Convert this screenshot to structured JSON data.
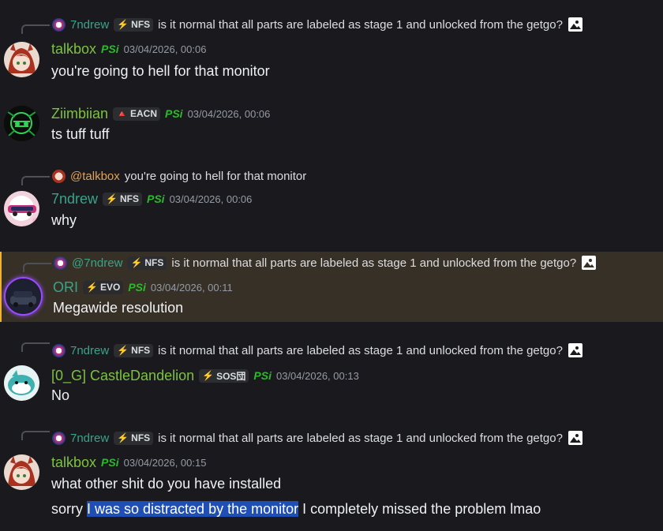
{
  "messages": [
    {
      "reply": {
        "name": "7ndrew",
        "tag": "NFS",
        "text": "is it normal that all parts are labeled as stage 1 and unlocked from the getgo?"
      },
      "author": "talkbox",
      "timestamp": "03/04/2026, 00:06",
      "content": "you're going to hell for that monitor"
    },
    {
      "author": "Ziimbiian",
      "tag": "EACN",
      "timestamp": "03/04/2026, 00:06",
      "content": "ts tuff tuff"
    },
    {
      "reply": {
        "name": "@talkbox",
        "text": "you're going to hell for that monitor"
      },
      "author": "7ndrew",
      "tag": "NFS",
      "timestamp": "03/04/2026, 00:06",
      "content": "why"
    },
    {
      "reply": {
        "name": "@7ndrew",
        "tag": "NFS",
        "text": "is it normal that all parts are labeled as stage 1 and unlocked from the getgo?"
      },
      "author": "ORI",
      "tag": "EVO",
      "timestamp": "03/04/2026, 00:11",
      "content": "Megawide resolution"
    },
    {
      "reply": {
        "name": "7ndrew",
        "tag": "NFS",
        "text": "is it normal that all parts are labeled as stage 1 and unlocked from the getgo?"
      },
      "author": "[0_G] CastleDandelion",
      "tag": "SOS団",
      "timestamp": "03/04/2026, 00:13",
      "content": "No"
    },
    {
      "reply": {
        "name": "7ndrew",
        "tag": "NFS",
        "text": "is it normal that all parts are labeled as stage 1 and unlocked from the getgo?"
      },
      "author": "talkbox",
      "timestamp": "03/04/2026, 00:15",
      "content": "what other shit do you have installed",
      "content2_pre": "sorry ",
      "content2_sel": "I was so distracted by the monitor",
      "content2_post": " I completely missed the problem lmao"
    }
  ],
  "psi_badge": "PSi",
  "colors": {
    "background": "#1a1a1e",
    "highlight": "#373026",
    "selection": "#1f4fb5",
    "name_green": "#7cc242",
    "name_teal": "#3ba28a",
    "name_orange": "#e0a35a"
  }
}
